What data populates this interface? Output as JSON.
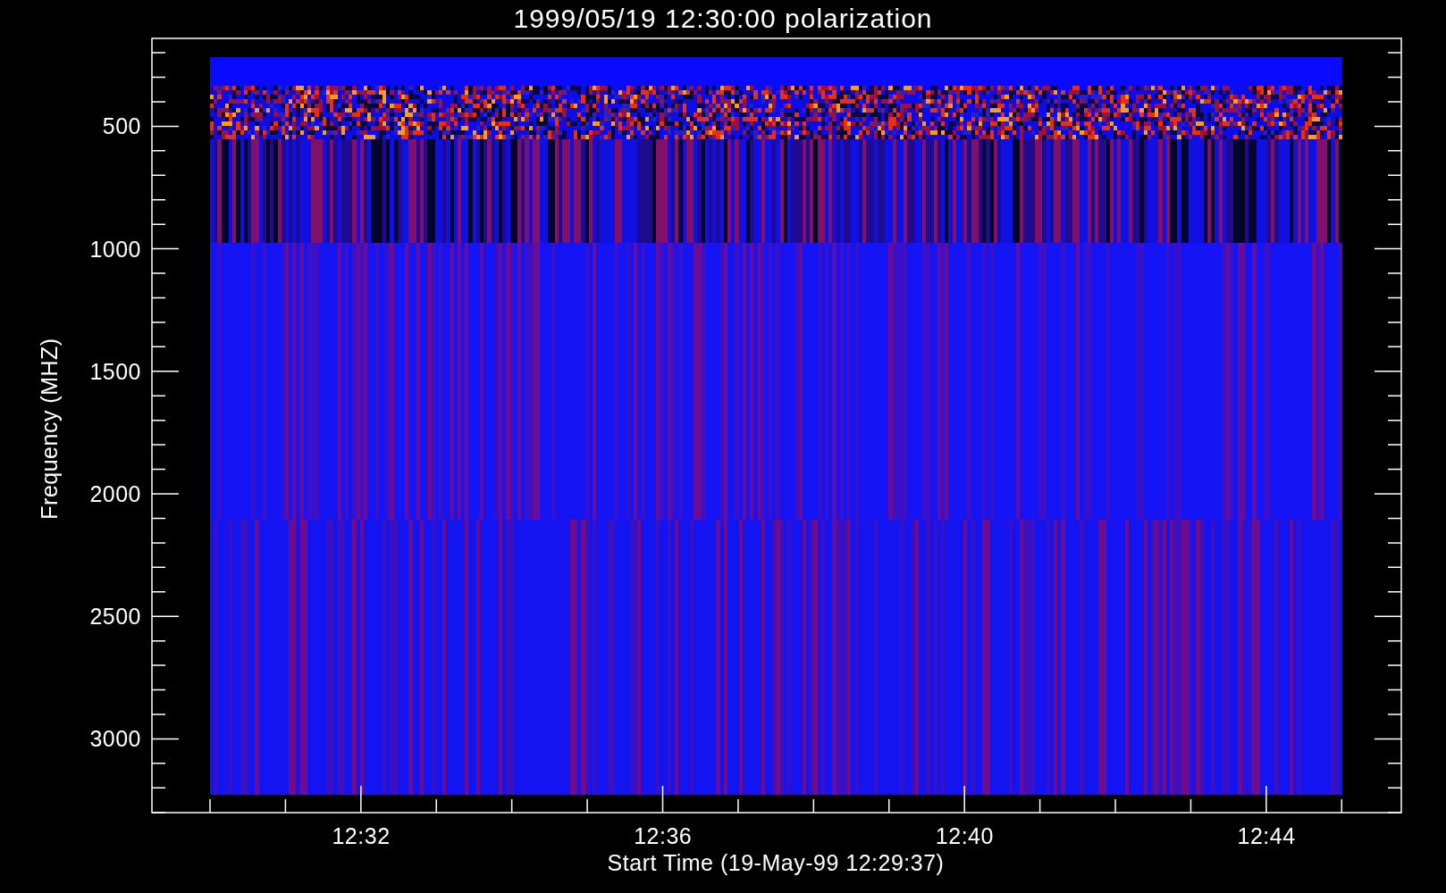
{
  "title": "1999/05/19 12:30:00 polarization",
  "ylabel": "Frequency (MHZ)",
  "xlabel": "Start Time (19-May-99 12:29:37)",
  "yticks": [
    "500",
    "1000",
    "1500",
    "2000",
    "2500",
    "3000"
  ],
  "xticks": [
    "12:32",
    "12:36",
    "12:40",
    "12:44"
  ]
}
